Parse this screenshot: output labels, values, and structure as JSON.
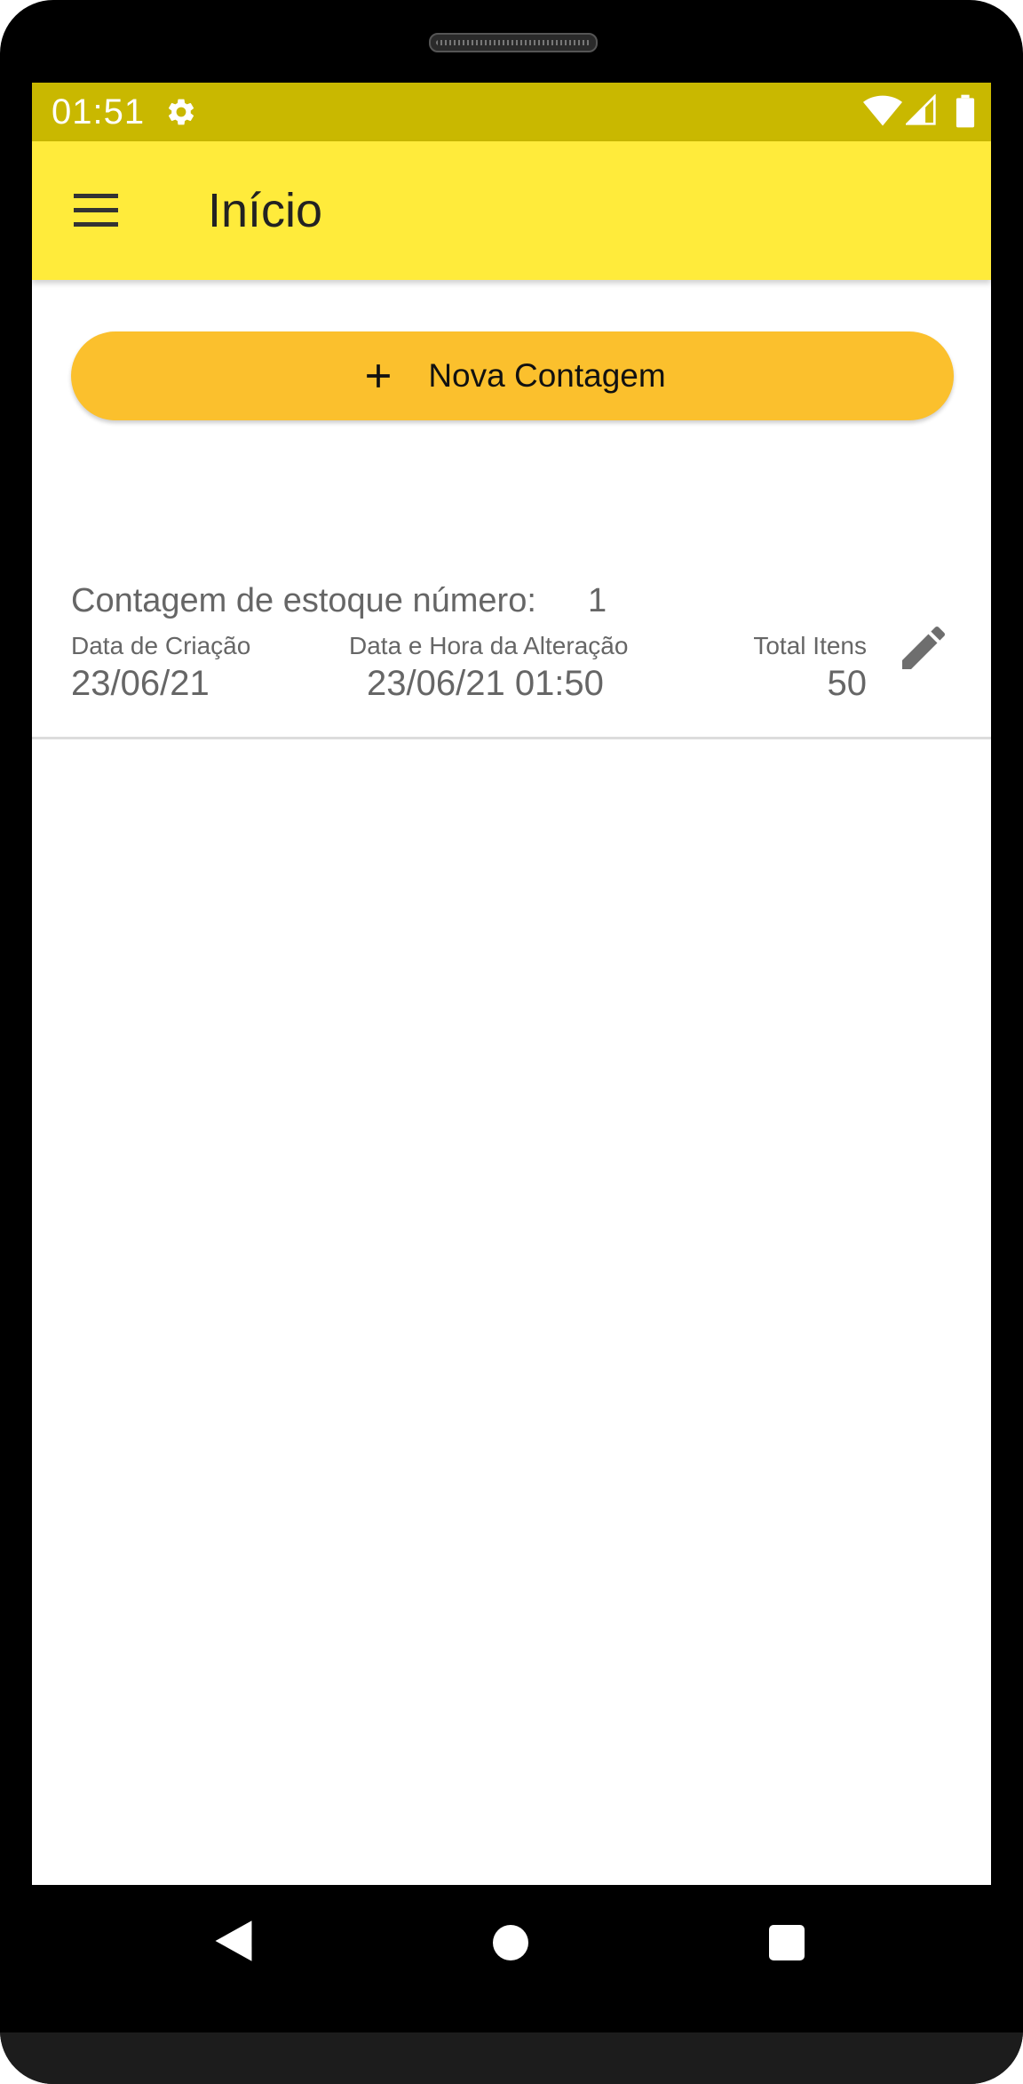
{
  "status_bar": {
    "time": "01:51",
    "icons": [
      "gear-icon",
      "wifi-icon",
      "signal-icon",
      "battery-icon"
    ]
  },
  "appbar": {
    "title": "Início",
    "menu_icon": "menu-icon"
  },
  "new_button": {
    "label": "Nova Contagem",
    "icon": "plus-icon"
  },
  "counts": [
    {
      "heading": "Contagem de estoque número:",
      "number": "1",
      "created_label": "Data de Criação",
      "created_value": "23/06/21",
      "modified_label": "Data e Hora da Alteração",
      "modified_value": "23/06/21 01:50",
      "total_label": "Total Itens",
      "total_value": "50",
      "action_icon": "edit-icon"
    }
  ],
  "navbar": {
    "icons": [
      "back-icon",
      "home-icon",
      "recents-icon"
    ]
  },
  "colors": {
    "status_bar": "#c9b800",
    "appbar": "#ffeb3b",
    "button": "#fbc02d",
    "text_secondary": "#666666"
  }
}
